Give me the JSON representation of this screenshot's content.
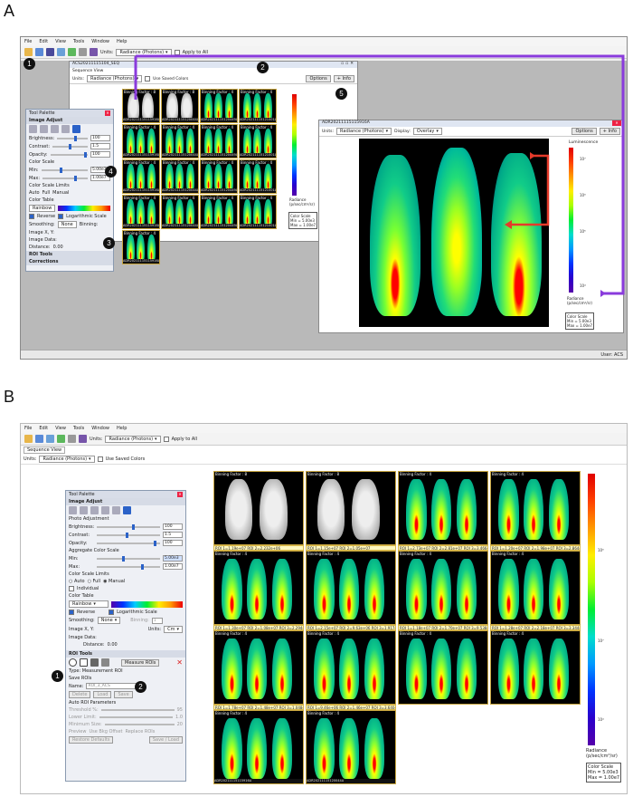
{
  "panel_a": {
    "letter": "A"
  },
  "panel_b": {
    "letter": "B"
  },
  "menu": [
    "File",
    "Edit",
    "View",
    "Tools",
    "Window",
    "Help"
  ],
  "toolbar": {
    "units_label": "Units:",
    "units_value": "Radiance (Photons)",
    "apply_all": "Apply to All"
  },
  "seq_window": {
    "title": "ACS20211115104_SEQ",
    "tab": "Sequence View",
    "units_label": "Units:",
    "units_value": "Radiance (Photons)",
    "use_saved_colors": "Use Saved Colors",
    "options": "Options",
    "info": "+ Info"
  },
  "single_window": {
    "title": "ADR20211115115916A",
    "units_label": "Units:",
    "units_value": "Radiance (Photons)",
    "display_label": "Display:",
    "display_value": "Overlay",
    "options": "Options",
    "info": "+ Info"
  },
  "colorbar": {
    "title": "Luminescence",
    "unit_line1": "Radiance",
    "unit_line2": "(p/sec/cm²/sr)",
    "scale_line1": "Color Scale",
    "scale_min": "Min = 5.00e3",
    "scale_max": "Max = 1.00e7",
    "exp7": "10⁷",
    "exp6": "10⁶",
    "exp5": "10⁵",
    "exp4": "10⁴"
  },
  "thumb_labels": {
    "b8": "Binning Factor : 8",
    "b4": "Binning Factor : 4"
  },
  "tool_palette": {
    "title": "Tool Palette",
    "image_adjust": "Image Adjust",
    "photo_adjustment": "Photo Adjustment",
    "brightness": "Brightness:",
    "brightness_val": "100",
    "contrast": "Contrast:",
    "contrast_val": "1.5",
    "opacity": "Opacity:",
    "opacity_val": "100",
    "aggregate": "Aggregate Color Scale",
    "color_scale": "Color Scale",
    "min": "Min:",
    "min_val": "5.00e3",
    "max": "Max:",
    "max_val": "1.00e7",
    "limits": "Color Scale Limits",
    "auto": "Auto",
    "full": "Full",
    "manual": "Manual",
    "individual": "Individual",
    "color_table": "Color Table",
    "rainbow": "Rainbow",
    "reverse": "Reverse",
    "log_scale": "Logarithmic Scale",
    "smoothing": "Smoothing:",
    "none": "None",
    "binning": "Binning:",
    "binning_val": "1",
    "image_xy": "Image X, Y:",
    "units": "Units:",
    "units_val": "Cm",
    "image_data": "Image Data:",
    "distance": "Distance:",
    "distance_val": "0.00",
    "roi_tools": "ROI Tools",
    "corrections": "Corrections",
    "measure": "Measure ROIs",
    "type": "Type: Measurement ROI",
    "save_rois": "Save ROIs",
    "name": "Name:",
    "name_val": "ROI_3_ACS",
    "delete": "Delete",
    "load": "Load",
    "save": "Save",
    "auto_params": "Auto ROI Parameters",
    "threshold": "Threshold %:",
    "threshold_val": "95",
    "lower": "Lower Limit:",
    "lower_val": "1.0",
    "min_size": "Minimum Size:",
    "min_size_val": "20",
    "preview": "Preview",
    "bkg_offset": "Use Bkg Offset",
    "replace": "Replace ROIs",
    "restore": "Restore Defaults",
    "save_load": "Save / Load"
  },
  "roi_labels": [
    "ROI 1=1.19e+07 ROI 2=2.232e+06",
    "ROI 1=1.15e+07 ROI 2=1.05e+07",
    "ROI 1=2.73e+07 ROI 2=2.81e+07 ROI 3=3.466e+06",
    "ROI 1=1.20e+07 ROI 2=1.98e+07 ROI 3=2.864e+07",
    "ROI 1=1.30e+07 ROI 2=1.08e+07 ROI 3=2.294e+06",
    "ROI 1=2.15e+07 ROI 2=9.63e+06 ROI 3=1.917e+06",
    "ROI 1=1.18e+07 ROI 2=1.70e+07 ROI 3=9.538e+06",
    "ROI 1=1.28e+07 ROI 2=2.18e+07 ROI 3=3.344e+07",
    "ROI 1=1.78e+07 ROI 2=1.48e+07 ROI 3=1.048e+07",
    "ROI 1=9.46e+06 ROI 2=1.46e+07 ROI 3=3.640e+07"
  ],
  "thumb_footers": [
    "ADR20211115115916A",
    "ADR20211115120044A",
    "ADR20211115120449A",
    "ADR20211115121001A"
  ],
  "status": "User: ACS",
  "badges": [
    "1",
    "2",
    "3",
    "4",
    "5"
  ],
  "colors": {
    "accent_purple": "#8a3bdc",
    "accent_red": "#e53a2a",
    "window_gray": "#b9b9b9"
  }
}
